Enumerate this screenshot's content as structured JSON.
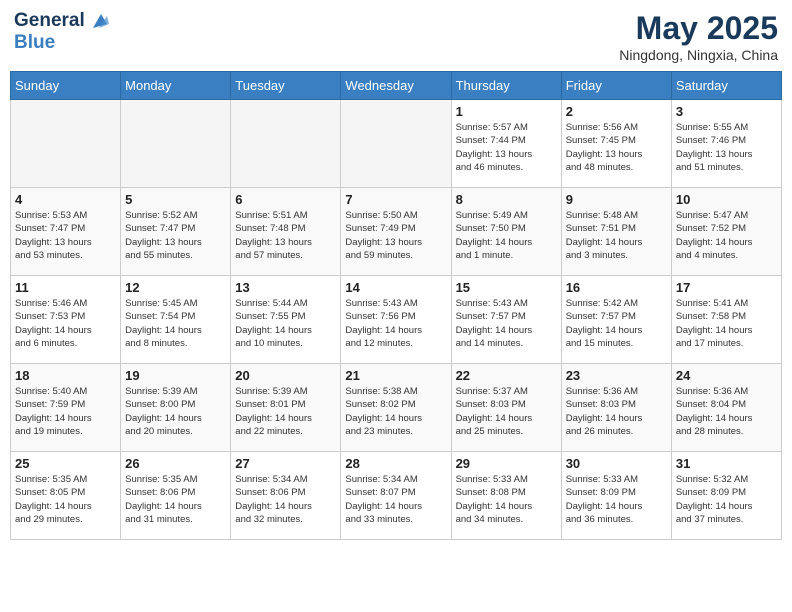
{
  "header": {
    "logo_line1": "General",
    "logo_line2": "Blue",
    "month": "May 2025",
    "location": "Ningdong, Ningxia, China"
  },
  "weekdays": [
    "Sunday",
    "Monday",
    "Tuesday",
    "Wednesday",
    "Thursday",
    "Friday",
    "Saturday"
  ],
  "weeks": [
    [
      {
        "day": "",
        "info": ""
      },
      {
        "day": "",
        "info": ""
      },
      {
        "day": "",
        "info": ""
      },
      {
        "day": "",
        "info": ""
      },
      {
        "day": "1",
        "info": "Sunrise: 5:57 AM\nSunset: 7:44 PM\nDaylight: 13 hours\nand 46 minutes."
      },
      {
        "day": "2",
        "info": "Sunrise: 5:56 AM\nSunset: 7:45 PM\nDaylight: 13 hours\nand 48 minutes."
      },
      {
        "day": "3",
        "info": "Sunrise: 5:55 AM\nSunset: 7:46 PM\nDaylight: 13 hours\nand 51 minutes."
      }
    ],
    [
      {
        "day": "4",
        "info": "Sunrise: 5:53 AM\nSunset: 7:47 PM\nDaylight: 13 hours\nand 53 minutes."
      },
      {
        "day": "5",
        "info": "Sunrise: 5:52 AM\nSunset: 7:47 PM\nDaylight: 13 hours\nand 55 minutes."
      },
      {
        "day": "6",
        "info": "Sunrise: 5:51 AM\nSunset: 7:48 PM\nDaylight: 13 hours\nand 57 minutes."
      },
      {
        "day": "7",
        "info": "Sunrise: 5:50 AM\nSunset: 7:49 PM\nDaylight: 13 hours\nand 59 minutes."
      },
      {
        "day": "8",
        "info": "Sunrise: 5:49 AM\nSunset: 7:50 PM\nDaylight: 14 hours\nand 1 minute."
      },
      {
        "day": "9",
        "info": "Sunrise: 5:48 AM\nSunset: 7:51 PM\nDaylight: 14 hours\nand 3 minutes."
      },
      {
        "day": "10",
        "info": "Sunrise: 5:47 AM\nSunset: 7:52 PM\nDaylight: 14 hours\nand 4 minutes."
      }
    ],
    [
      {
        "day": "11",
        "info": "Sunrise: 5:46 AM\nSunset: 7:53 PM\nDaylight: 14 hours\nand 6 minutes."
      },
      {
        "day": "12",
        "info": "Sunrise: 5:45 AM\nSunset: 7:54 PM\nDaylight: 14 hours\nand 8 minutes."
      },
      {
        "day": "13",
        "info": "Sunrise: 5:44 AM\nSunset: 7:55 PM\nDaylight: 14 hours\nand 10 minutes."
      },
      {
        "day": "14",
        "info": "Sunrise: 5:43 AM\nSunset: 7:56 PM\nDaylight: 14 hours\nand 12 minutes."
      },
      {
        "day": "15",
        "info": "Sunrise: 5:43 AM\nSunset: 7:57 PM\nDaylight: 14 hours\nand 14 minutes."
      },
      {
        "day": "16",
        "info": "Sunrise: 5:42 AM\nSunset: 7:57 PM\nDaylight: 14 hours\nand 15 minutes."
      },
      {
        "day": "17",
        "info": "Sunrise: 5:41 AM\nSunset: 7:58 PM\nDaylight: 14 hours\nand 17 minutes."
      }
    ],
    [
      {
        "day": "18",
        "info": "Sunrise: 5:40 AM\nSunset: 7:59 PM\nDaylight: 14 hours\nand 19 minutes."
      },
      {
        "day": "19",
        "info": "Sunrise: 5:39 AM\nSunset: 8:00 PM\nDaylight: 14 hours\nand 20 minutes."
      },
      {
        "day": "20",
        "info": "Sunrise: 5:39 AM\nSunset: 8:01 PM\nDaylight: 14 hours\nand 22 minutes."
      },
      {
        "day": "21",
        "info": "Sunrise: 5:38 AM\nSunset: 8:02 PM\nDaylight: 14 hours\nand 23 minutes."
      },
      {
        "day": "22",
        "info": "Sunrise: 5:37 AM\nSunset: 8:03 PM\nDaylight: 14 hours\nand 25 minutes."
      },
      {
        "day": "23",
        "info": "Sunrise: 5:36 AM\nSunset: 8:03 PM\nDaylight: 14 hours\nand 26 minutes."
      },
      {
        "day": "24",
        "info": "Sunrise: 5:36 AM\nSunset: 8:04 PM\nDaylight: 14 hours\nand 28 minutes."
      }
    ],
    [
      {
        "day": "25",
        "info": "Sunrise: 5:35 AM\nSunset: 8:05 PM\nDaylight: 14 hours\nand 29 minutes."
      },
      {
        "day": "26",
        "info": "Sunrise: 5:35 AM\nSunset: 8:06 PM\nDaylight: 14 hours\nand 31 minutes."
      },
      {
        "day": "27",
        "info": "Sunrise: 5:34 AM\nSunset: 8:06 PM\nDaylight: 14 hours\nand 32 minutes."
      },
      {
        "day": "28",
        "info": "Sunrise: 5:34 AM\nSunset: 8:07 PM\nDaylight: 14 hours\nand 33 minutes."
      },
      {
        "day": "29",
        "info": "Sunrise: 5:33 AM\nSunset: 8:08 PM\nDaylight: 14 hours\nand 34 minutes."
      },
      {
        "day": "30",
        "info": "Sunrise: 5:33 AM\nSunset: 8:09 PM\nDaylight: 14 hours\nand 36 minutes."
      },
      {
        "day": "31",
        "info": "Sunrise: 5:32 AM\nSunset: 8:09 PM\nDaylight: 14 hours\nand 37 minutes."
      }
    ]
  ]
}
